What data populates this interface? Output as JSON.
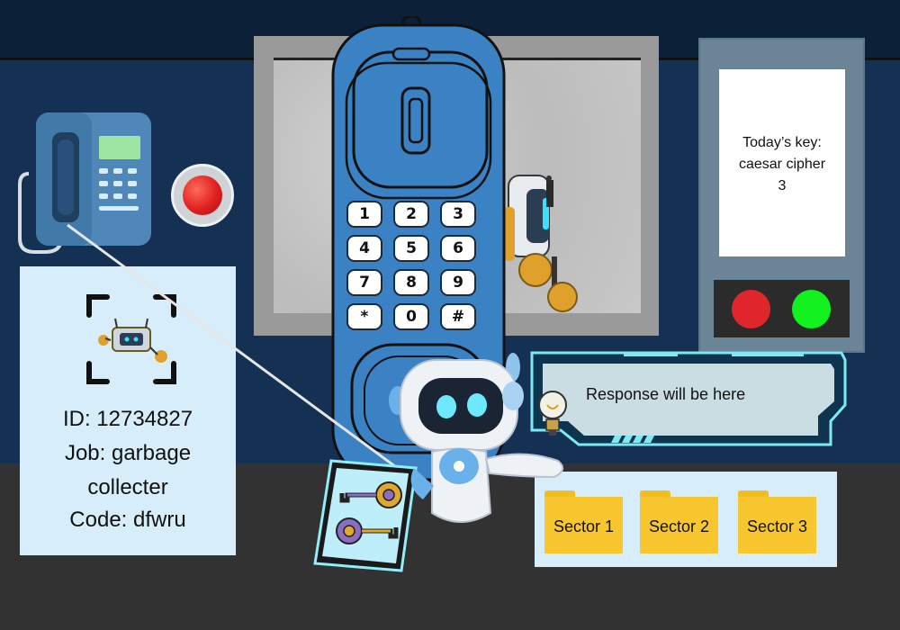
{
  "id_card": {
    "id_line": "ID: 12734827",
    "job_line_1": "Job: garbage",
    "job_line_2": "collecter",
    "code_line": "Code: dfwru"
  },
  "key_note": {
    "line_1": "Today’s key:",
    "line_2": "caesar cipher",
    "line_3": "3"
  },
  "keypad": {
    "keys": [
      "1",
      "2",
      "3",
      "4",
      "5",
      "6",
      "7",
      "8",
      "9",
      "*",
      "0",
      "#"
    ]
  },
  "response": {
    "text": "Response will be here"
  },
  "sectors": [
    {
      "label": "Sector 1"
    },
    {
      "label": "Sector 2"
    },
    {
      "label": "Sector 3"
    }
  ],
  "colors": {
    "phone_blue": "#3b82c4",
    "id_card_bg": "#d7eefa",
    "status_red": "#e0262b",
    "status_green": "#12f21e",
    "folder_yellow": "#f8c62f",
    "response_cyan": "#7fe9f3"
  },
  "icons": {
    "wall_phone": "telephone-icon",
    "alarm": "red-button-icon",
    "robot": "robot-icon",
    "keycard": "keys-icon",
    "hint": "lightbulb-icon",
    "folders": "folder-icon"
  }
}
